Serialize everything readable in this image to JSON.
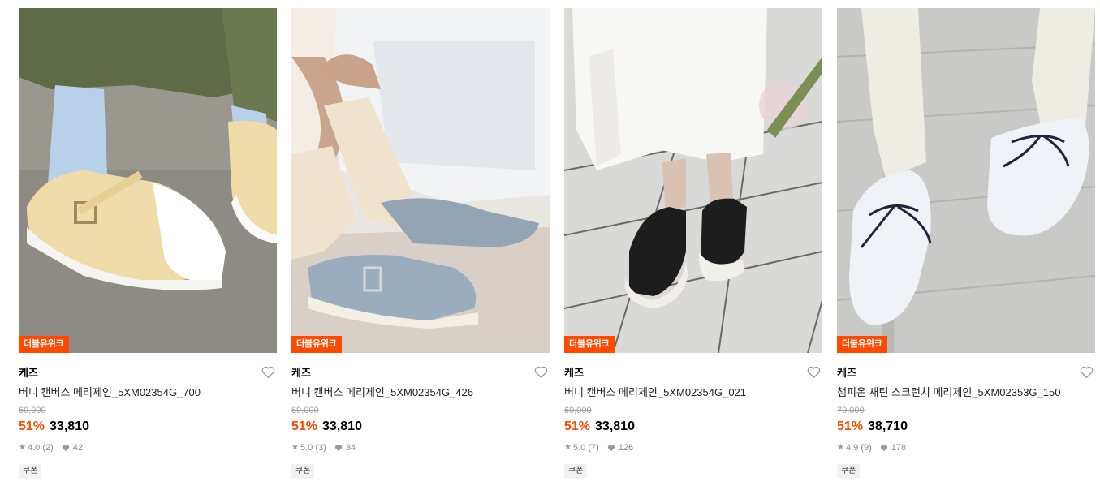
{
  "products": [
    {
      "badge": "더블유위크",
      "brand": "케즈",
      "title": "버니 캔버스 메리제인_5XM02354G_700",
      "original_price": "69,000",
      "discount": "51%",
      "price": "33,810",
      "rating": "4.0",
      "review_count": "(2)",
      "likes": "42",
      "tag": "쿠폰",
      "image": "yellow-maryjane-sneaker-photo"
    },
    {
      "badge": "더블유위크",
      "brand": "케즈",
      "title": "버니 캔버스 메리제인_5XM02354G_426",
      "original_price": "69,000",
      "discount": "51%",
      "price": "33,810",
      "rating": "5.0",
      "review_count": "(3)",
      "likes": "34",
      "tag": "쿠폰",
      "image": "blue-maryjane-sneaker-photo"
    },
    {
      "badge": "더블유위크",
      "brand": "케즈",
      "title": "버니 캔버스 메리제인_5XM02354G_021",
      "original_price": "69,000",
      "discount": "51%",
      "price": "33,810",
      "rating": "5.0",
      "review_count": "(7)",
      "likes": "126",
      "tag": "쿠폰",
      "image": "black-maryjane-sneaker-photo"
    },
    {
      "badge": "더블유위크",
      "brand": "케즈",
      "title": "챔피온 새틴 스크런치 메리제인_5XM02353G_150",
      "original_price": "79,000",
      "discount": "51%",
      "price": "38,710",
      "rating": "4.9",
      "review_count": "(9)",
      "likes": "178",
      "tag": "쿠폰",
      "image": "white-satin-bow-sneaker-photo"
    }
  ],
  "colors": {
    "accent": "#ff4800",
    "muted": "#a0a0a0"
  }
}
